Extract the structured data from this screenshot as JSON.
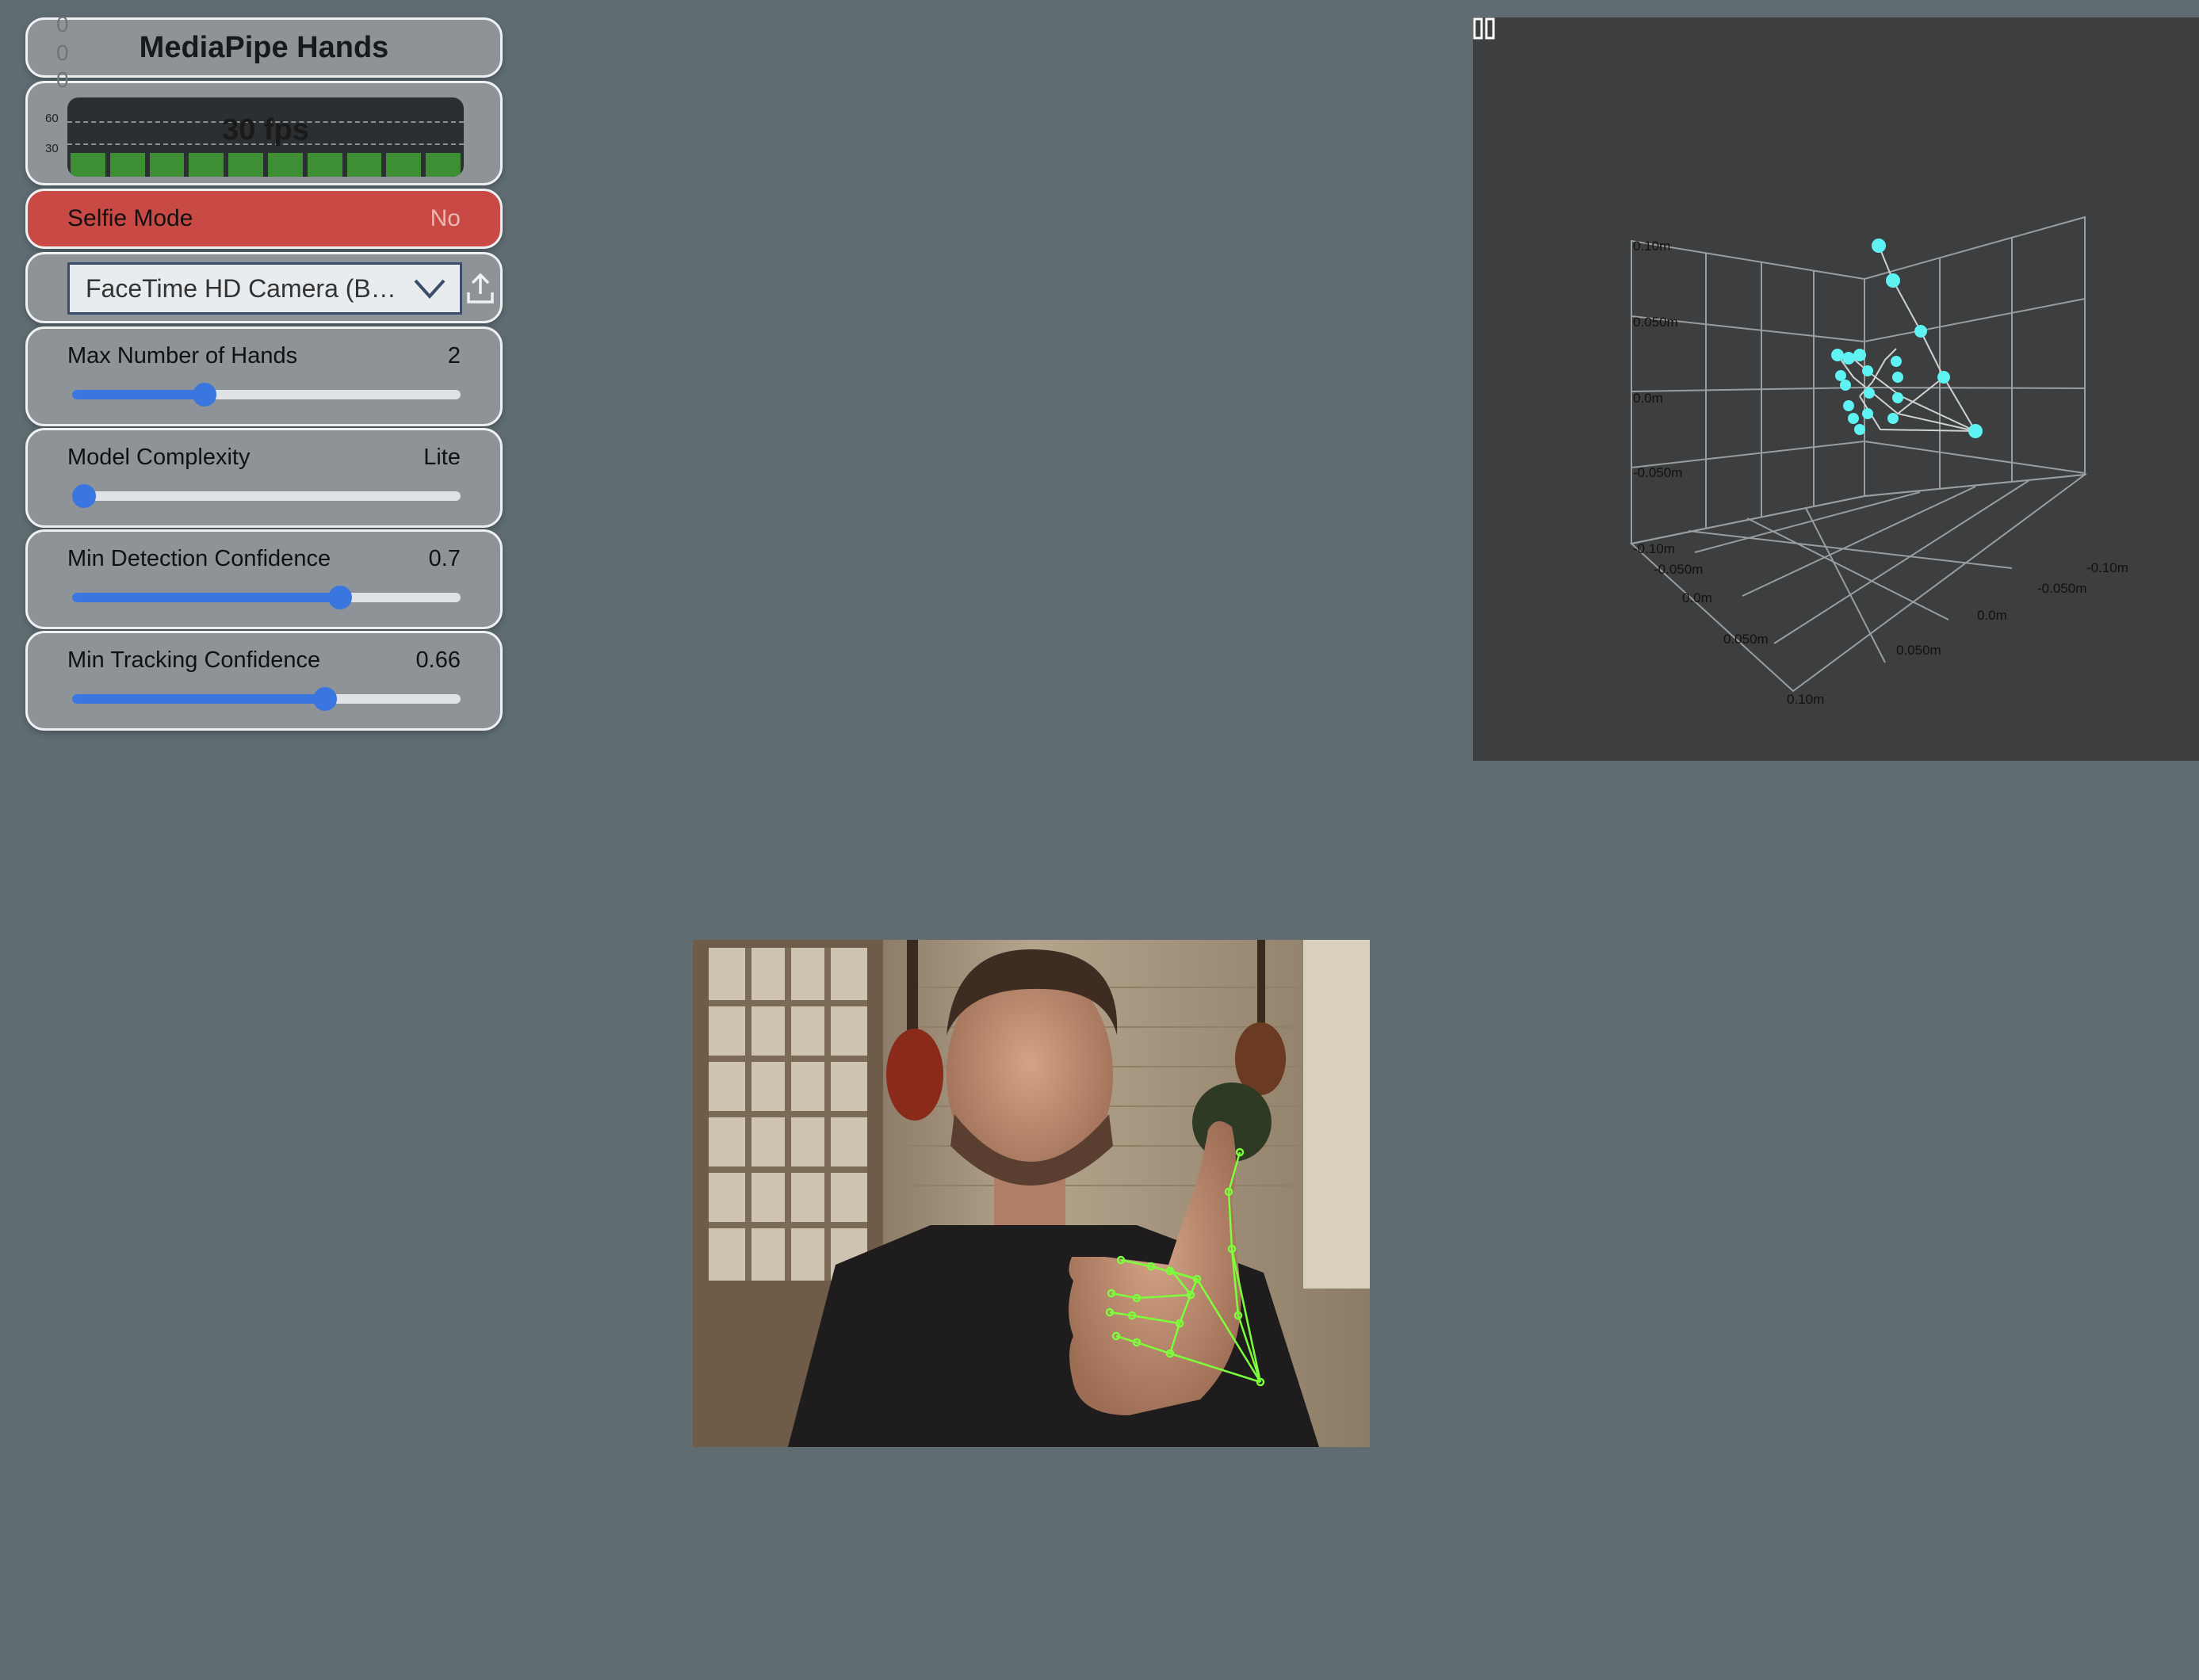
{
  "app": {
    "title": "MediaPipe Hands"
  },
  "fps": {
    "label": "30 fps",
    "tick_high": "60",
    "tick_low": "30",
    "ghost_digits": [
      "0",
      "0",
      "0"
    ]
  },
  "selfie": {
    "label": "Selfie Mode",
    "value": "No"
  },
  "camera": {
    "selected": "FaceTime HD Camera (B…"
  },
  "sliders": [
    {
      "label": "Max Number of Hands",
      "value": "2",
      "fraction": 0.34
    },
    {
      "label": "Model Complexity",
      "value": "Lite",
      "fraction": 0.0
    },
    {
      "label": "Min Detection Confidence",
      "value": "0.7",
      "fraction": 0.69
    },
    {
      "label": "Min Tracking Confidence",
      "value": "0.66",
      "fraction": 0.65
    }
  ],
  "plot3d": {
    "y_ticks": [
      "0.10m",
      "0.050m",
      "0.0m",
      "-0.050m",
      "-0.10m"
    ],
    "x_ticks": [
      "-0.050m",
      "0.0m",
      "0.050m",
      "0.10m"
    ],
    "z_ticks": [
      "-0.10m",
      "-0.050m",
      "0.0m",
      "0.050m"
    ],
    "point_color": "#5ef2f2"
  },
  "colors": {
    "background": "#5f6d73",
    "selfie_off": "#c94a44",
    "accent": "#3a76e0",
    "fps_bar": "#3e8e33",
    "landmark": "#7cff3a"
  },
  "icons": {
    "dropdown": "chevron-down-icon",
    "upload": "upload-icon",
    "pause": "pause-icon"
  }
}
